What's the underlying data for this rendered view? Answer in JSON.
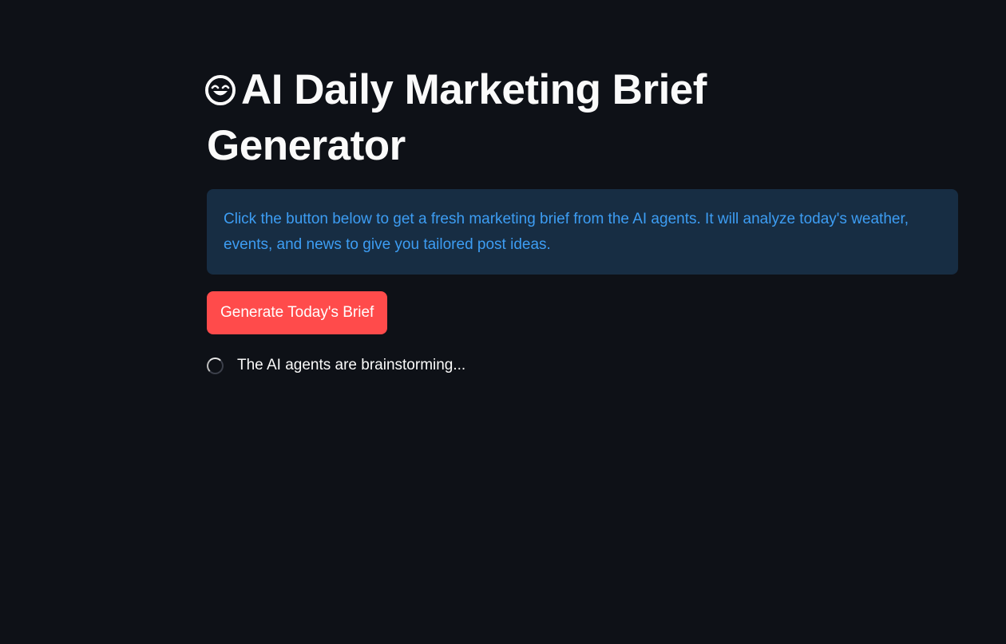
{
  "header": {
    "title_icon": "grinning-face-icon",
    "title": "AI Daily Marketing Brief Generator"
  },
  "info": {
    "text": "Click the button below to get a fresh marketing brief from the AI agents. It will analyze today's weather, events, and news to give you tailored post ideas."
  },
  "actions": {
    "generate_label": "Generate Today's Brief"
  },
  "status": {
    "icon": "loading-spinner-icon",
    "text": "The AI agents are brainstorming..."
  },
  "colors": {
    "background": "#0e1117",
    "info_background": "#172d43",
    "info_text": "#3d9df3",
    "button": "#ff4b4b",
    "text": "#fafafa"
  }
}
